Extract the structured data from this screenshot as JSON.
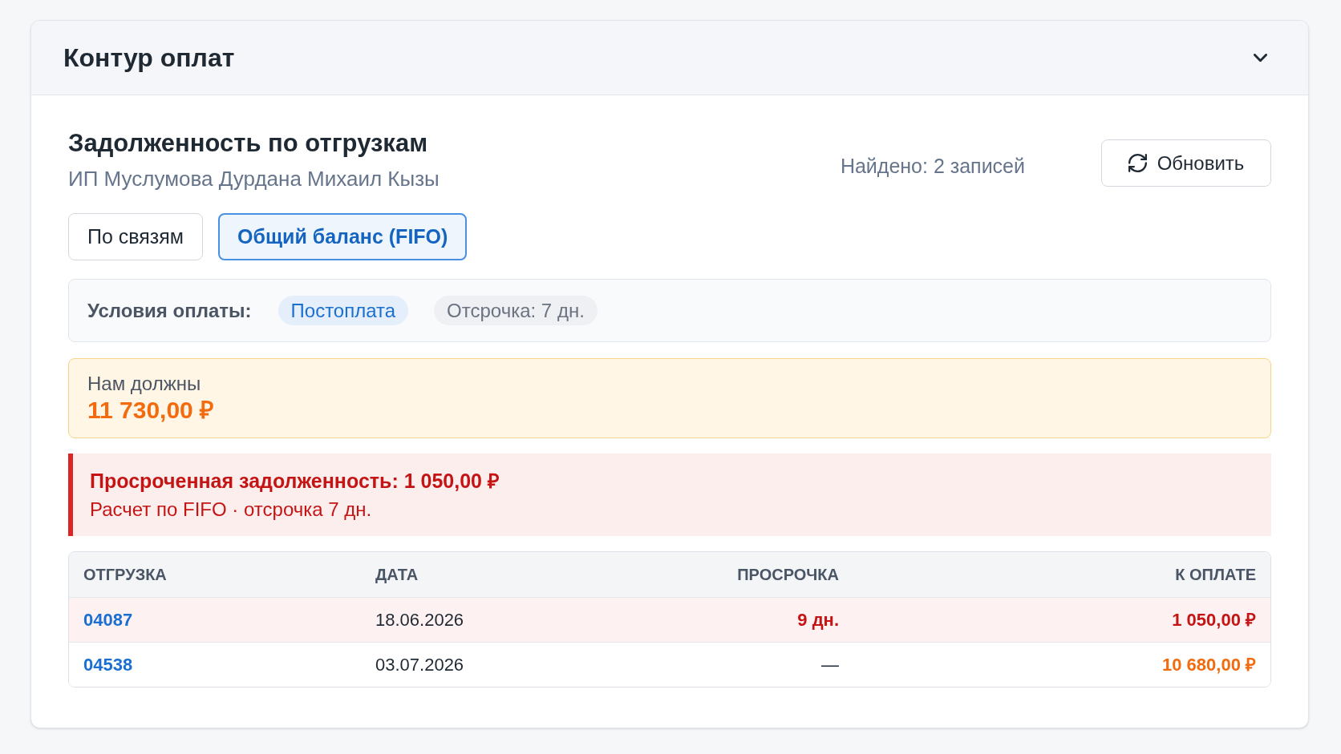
{
  "panel": {
    "title": "Контур оплат"
  },
  "section": {
    "title": "Задолженность по отгрузкам",
    "subtitle": "ИП Муслумова Дурдана Михаил Кызы",
    "found": "Найдено: 2 записей",
    "refresh_button": "Обновить"
  },
  "tabs": [
    {
      "label": "По связям",
      "selected": false
    },
    {
      "label": "Общий баланс (FIFO)",
      "selected": true
    }
  ],
  "payment_terms": {
    "label": "Условия оплаты:",
    "tags": [
      {
        "label": "Постоплата",
        "kind": "accent"
      },
      {
        "label": "Отсрочка: 7 дн.",
        "kind": "muted"
      }
    ]
  },
  "balance": {
    "label": "Нам должны",
    "amount": "11 730,00 ₽"
  },
  "overdue_alert": {
    "title": "Просроченная задолженность: 1 050,00 ₽",
    "detail": "Расчет по FIFO · отсрочка 7 дн."
  },
  "table": {
    "columns": [
      "ОТГРУЗКА",
      "ДАТА",
      "ПРОСРОЧКА",
      "К ОПЛАТЕ"
    ],
    "rows": [
      {
        "shipment": "04087",
        "date": "18.06.2026",
        "delay": "9 дн.",
        "amount": "1 050,00 ₽",
        "overdue": true
      },
      {
        "shipment": "04538",
        "date": "03.07.2026",
        "delay": "—",
        "amount": "10 680,00 ₽",
        "overdue": false
      }
    ]
  }
}
